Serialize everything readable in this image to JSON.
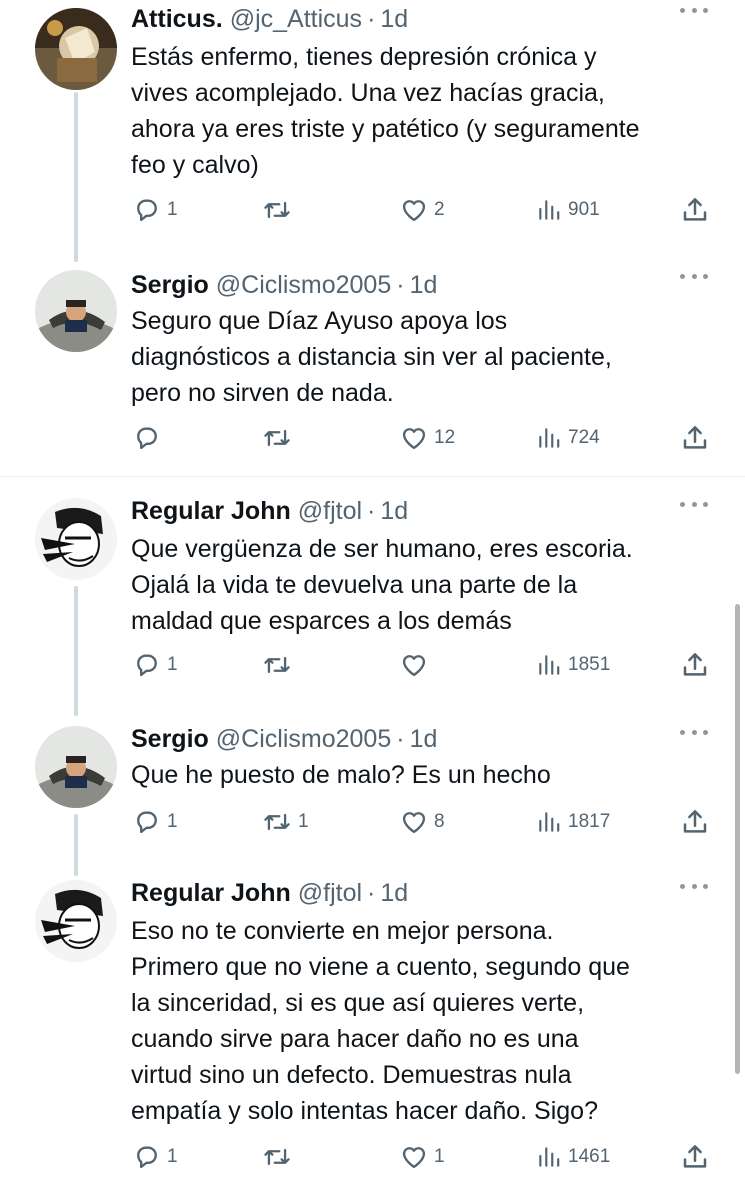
{
  "tweets": [
    {
      "name": "Atticus.",
      "handle": "@jc_Atticus",
      "sep": "·",
      "time": "1d",
      "lines": [
        "Estás enfermo, tienes depresión crónica y",
        "vives acomplejado. Una vez hacías gracia,",
        "ahora ya eres triste y patético (y seguramente",
        "feo y calvo)"
      ],
      "replies": "1",
      "retweets": "",
      "likes": "2",
      "views": "901"
    },
    {
      "name": "Sergio",
      "handle": "@Ciclismo2005",
      "sep": "·",
      "time": "1d",
      "lines": [
        "Seguro que Díaz Ayuso apoya los",
        "diagnósticos a distancia sin ver al paciente,",
        "pero no sirven de nada."
      ],
      "replies": "",
      "retweets": "",
      "likes": "12",
      "views": "724"
    },
    {
      "name": "Regular John",
      "handle": "@fjtol",
      "sep": "·",
      "time": "1d",
      "lines": [
        "Que vergüenza de ser humano, eres escoria.",
        "Ojalá la vida te devuelva una parte de la",
        "maldad que esparces a los demás"
      ],
      "replies": "1",
      "retweets": "",
      "likes": "",
      "views": "1851"
    },
    {
      "name": "Sergio",
      "handle": "@Ciclismo2005",
      "sep": "·",
      "time": "1d",
      "lines": [
        "Que he puesto de malo? Es un hecho"
      ],
      "replies": "1",
      "retweets": "1",
      "likes": "8",
      "views": "1817"
    },
    {
      "name": "Regular John",
      "handle": "@fjtol",
      "sep": "·",
      "time": "1d",
      "lines": [
        "Eso no te convierte en mejor persona.",
        "Primero que no viene a cuento, segundo que",
        "la sinceridad, si es que así quieres verte,",
        "cuando sirve para hacer daño no es una",
        "virtud sino un defecto. Demuestras nula",
        "empatía y solo intentas hacer daño. Sigo?"
      ],
      "replies": "1",
      "retweets": "",
      "likes": "1",
      "views": "1461"
    }
  ]
}
